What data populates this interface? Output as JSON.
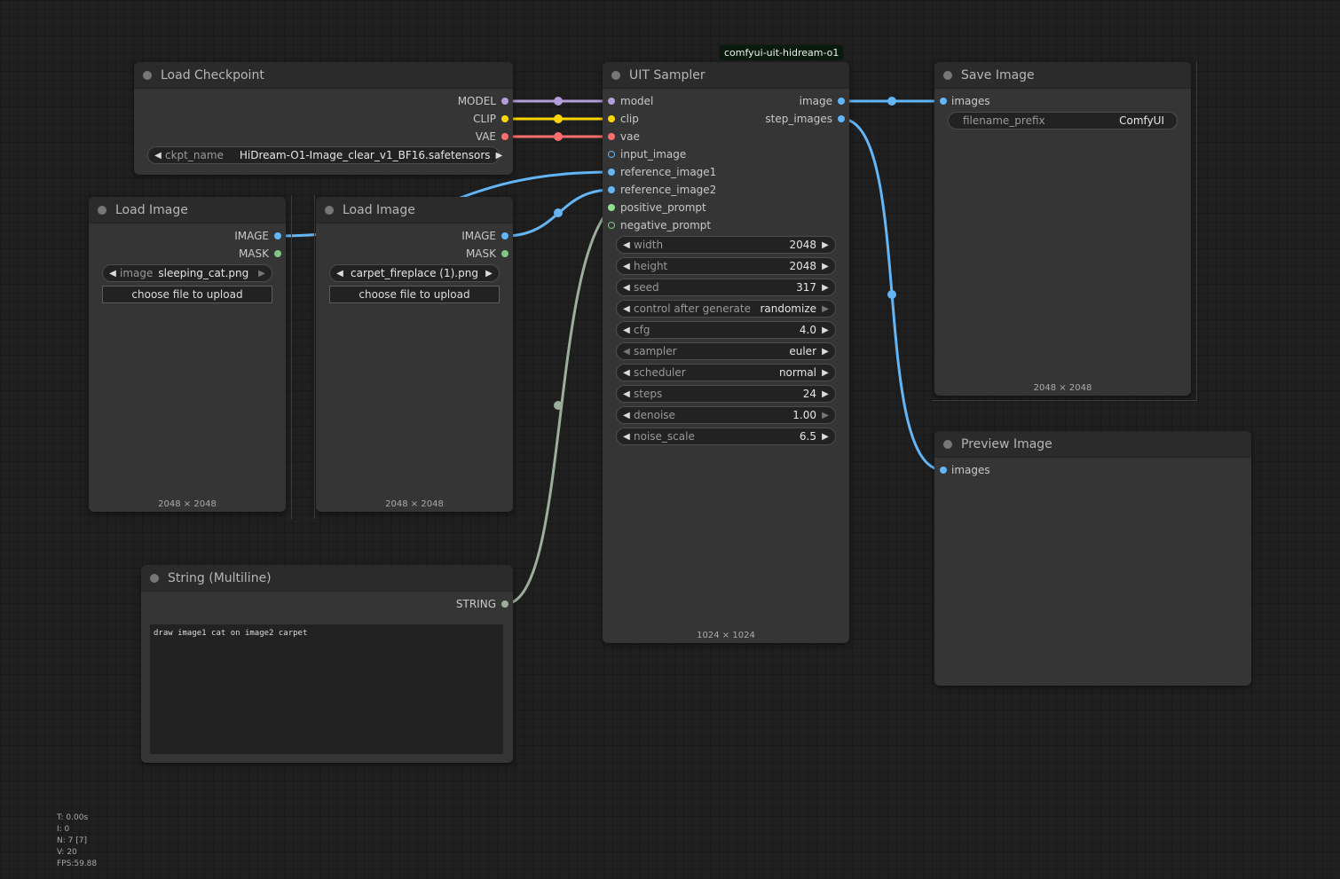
{
  "badge": "comfyui-uit-hidream-o1",
  "load_checkpoint": {
    "title": "Load Checkpoint",
    "outputs": [
      "MODEL",
      "CLIP",
      "VAE"
    ],
    "ckpt_label": "ckpt_name",
    "ckpt_value": "HiDream-O1-Image_clear_v1_BF16.safetensors"
  },
  "load_image_1": {
    "title": "Load Image",
    "outputs": [
      "IMAGE",
      "MASK"
    ],
    "image_label": "image",
    "image_value": "sleeping_cat.png",
    "upload_label": "choose file to upload",
    "size": "2048 × 2048"
  },
  "load_image_2": {
    "title": "Load Image",
    "outputs": [
      "IMAGE",
      "MASK"
    ],
    "image_value": "carpet_fireplace (1).png",
    "upload_label": "choose file to upload",
    "size": "2048 × 2048"
  },
  "string_node": {
    "title": "String (Multiline)",
    "output": "STRING",
    "text": "draw image1 cat on image2 carpet"
  },
  "sampler": {
    "title": "UIT Sampler",
    "inputs": [
      "model",
      "clip",
      "vae",
      "input_image",
      "reference_image1",
      "reference_image2",
      "positive_prompt",
      "negative_prompt"
    ],
    "outputs": [
      "image",
      "step_images"
    ],
    "widgets": [
      {
        "label": "width",
        "value": "2048"
      },
      {
        "label": "height",
        "value": "2048"
      },
      {
        "label": "seed",
        "value": "317"
      },
      {
        "label": "control after generate",
        "value": "randomize"
      },
      {
        "label": "cfg",
        "value": "4.0"
      },
      {
        "label": "sampler",
        "value": "euler"
      },
      {
        "label": "scheduler",
        "value": "normal"
      },
      {
        "label": "steps",
        "value": "24"
      },
      {
        "label": "denoise",
        "value": "1.00"
      },
      {
        "label": "noise_scale",
        "value": "6.5"
      }
    ],
    "size": "1024 × 1024"
  },
  "save_image": {
    "title": "Save Image",
    "input": "images",
    "prefix_label": "filename_prefix",
    "prefix_value": "ComfyUI",
    "size": "2048 × 2048"
  },
  "preview_image": {
    "title": "Preview Image",
    "input": "images"
  },
  "stats": [
    "T: 0.00s",
    "I: 0",
    "N: 7 [7]",
    "V: 20",
    "FPS:59.88"
  ],
  "colors": {
    "model": "#b39ddb",
    "clip": "#ffd500",
    "vae": "#ff6e6e",
    "image": "#64b5f6",
    "mask": "#81c784",
    "string": "#9caf9c",
    "conditioning": "#ffa931"
  }
}
